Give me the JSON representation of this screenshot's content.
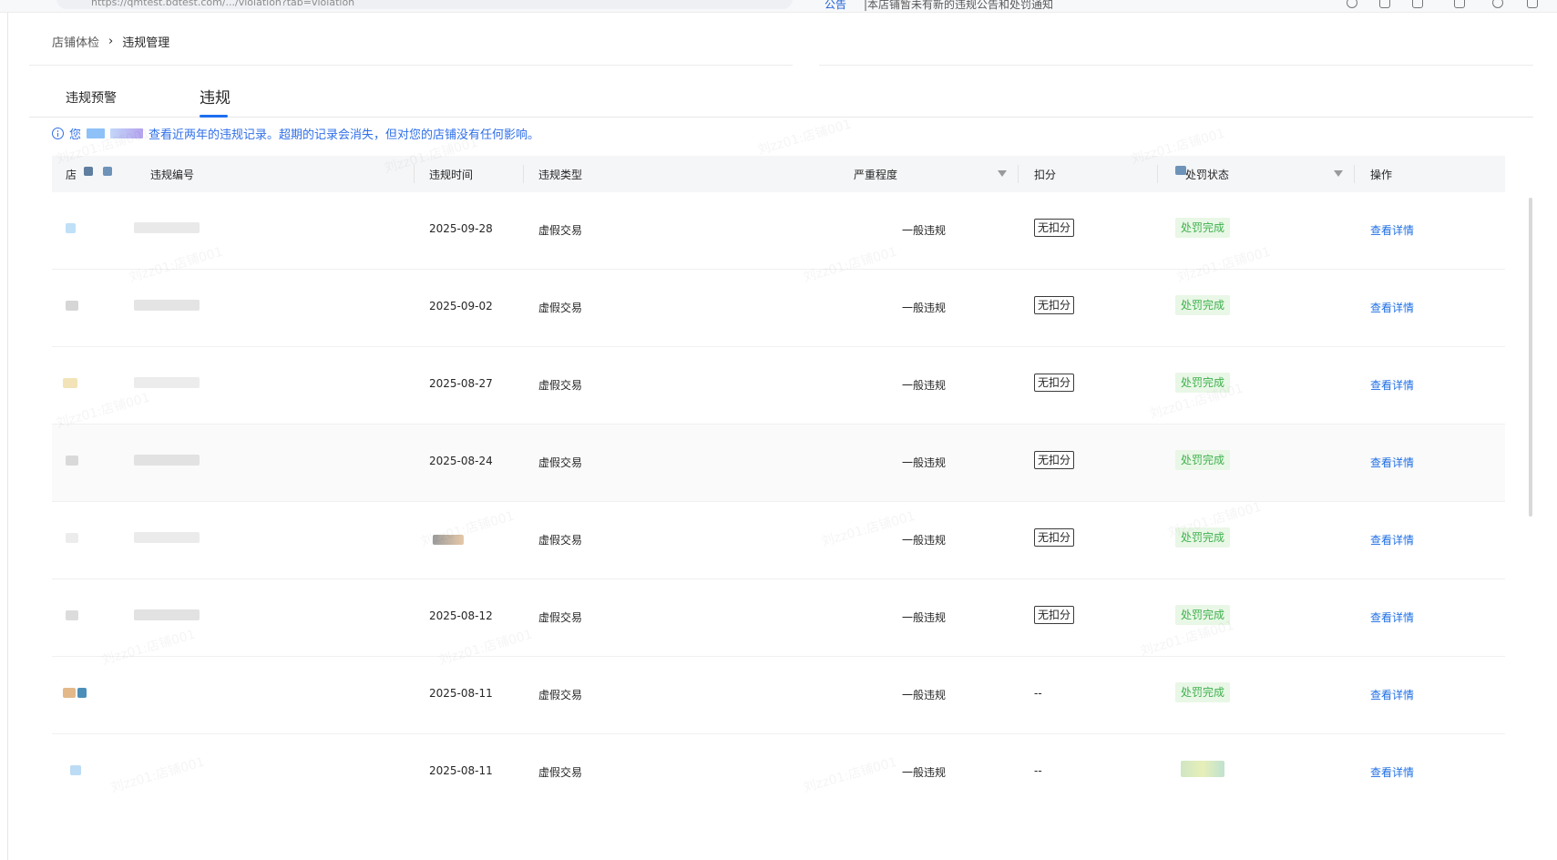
{
  "browser": {
    "url": "https://qmtest.bdtest.com/.../violation?tab=violation",
    "notice_label": "公告",
    "notice_text": "|本店铺暂未有新的违规公告和处罚通知"
  },
  "breadcrumb": {
    "parent": "店铺体检",
    "separator": "›",
    "current": "违规管理"
  },
  "tabs": [
    {
      "label": "违规预警",
      "active": false
    },
    {
      "label": "违规",
      "active": true
    }
  ],
  "info": {
    "prefix": "您",
    "text": "查看近两年的违规记录。超期的记录会消失，但对您的店铺没有任何影响。"
  },
  "table": {
    "columns": {
      "shop": "店",
      "violation_id": "违规编号",
      "time": "违规时间",
      "type": "违规类型",
      "severity": "严重程度",
      "deduction": "扣分",
      "status": "处罚状态",
      "action": "操作"
    },
    "rows": [
      {
        "time": "2025-09-28",
        "type": "虚假交易",
        "severity": "一般违规",
        "deduction": "无扣分",
        "status": "处罚完成",
        "action": "查看详情"
      },
      {
        "time": "2025-09-02",
        "type": "虚假交易",
        "severity": "一般违规",
        "deduction": "无扣分",
        "status": "处罚完成",
        "action": "查看详情"
      },
      {
        "time": "2025-08-27",
        "type": "虚假交易",
        "severity": "一般违规",
        "deduction": "无扣分",
        "status": "处罚完成",
        "action": "查看详情"
      },
      {
        "time": "2025-08-24",
        "type": "虚假交易",
        "severity": "一般违规",
        "deduction": "无扣分",
        "status": "处罚完成",
        "action": "查看详情"
      },
      {
        "time": "",
        "type": "虚假交易",
        "severity": "一般违规",
        "deduction": "无扣分",
        "status": "处罚完成",
        "action": "查看详情"
      },
      {
        "time": "2025-08-12",
        "type": "虚假交易",
        "severity": "一般违规",
        "deduction": "无扣分",
        "status": "处罚完成",
        "action": "查看详情"
      },
      {
        "time": "2025-08-11",
        "type": "虚假交易",
        "severity": "一般违规",
        "deduction": "--",
        "status": "处罚完成",
        "action": "查看详情"
      },
      {
        "time": "2025-08-11",
        "type": "虚假交易",
        "severity": "一般违规",
        "deduction": "--",
        "status": "",
        "action": "查看详情"
      }
    ]
  },
  "watermark": "刘zz01:店铺001",
  "colors": {
    "accent": "#1d6ff0",
    "success_text": "#3fb14f",
    "success_bg": "#e9f7e6",
    "header_bg": "#f5f6f8"
  }
}
